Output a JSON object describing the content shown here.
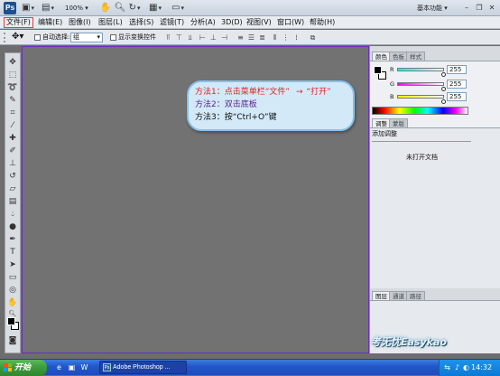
{
  "titlebar": {
    "logo": "Ps",
    "zoom": "100%",
    "workspace_label": "基本功能",
    "workspace_arrow": "▾",
    "window_buttons": {
      "minimize": "–",
      "restore": "❐",
      "close": "✕"
    },
    "icons": [
      "bridge-icon",
      "minibridge-icon",
      "hand-icon",
      "zoom-icon",
      "rotate-icon",
      "arrange-icon",
      "screen-mode-icon"
    ]
  },
  "menu": [
    "文件(F)",
    "编辑(E)",
    "图像(I)",
    "图层(L)",
    "选择(S)",
    "滤镜(T)",
    "分析(A)",
    "3D(D)",
    "视图(V)",
    "窗口(W)",
    "帮助(H)"
  ],
  "options": {
    "auto_select_label": "自动选择:",
    "auto_select_value": "组",
    "show_transform_label": "显示变换控件"
  },
  "callout": {
    "line1_prefix": "方法1：点击菜单栏",
    "line1_file": "“文件”",
    "line1_arrow": "→",
    "line1_open": "“打开”",
    "line2": "方法2：双击底板",
    "line3": "方法3：按“Ctrl+O”键",
    "colors": {
      "red": "#e02020",
      "purple": "#5a1e8c",
      "black": "#111111"
    }
  },
  "panels": {
    "color_tabs": [
      "颜色",
      "色板",
      "样式"
    ],
    "rgb": [
      {
        "label": "R",
        "value": "255"
      },
      {
        "label": "G",
        "value": "255"
      },
      {
        "label": "B",
        "value": "255"
      }
    ],
    "adjust_tabs": [
      "调整",
      "蒙版"
    ],
    "adjust_title": "添加调整",
    "no_document": "未打开文档",
    "layer_tabs": [
      "图层",
      "通道",
      "路径"
    ]
  },
  "taskbar": {
    "start_label": "开始",
    "task_label": "Adobe Photoshop ...",
    "clock": "14:32"
  },
  "watermark": "考无忧Easykao"
}
